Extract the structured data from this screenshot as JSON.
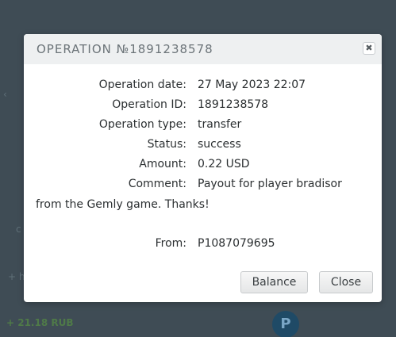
{
  "background": {
    "amount_text": "+ 21.18 RUB",
    "avatar_letter": "P"
  },
  "modal": {
    "title": "OPERATION №1891238578",
    "close_glyph": "✖",
    "fields": {
      "date_label": "Operation date:",
      "date_value": "27 May 2023 22:07",
      "id_label": "Operation ID:",
      "id_value": "1891238578",
      "type_label": "Operation type:",
      "type_value": "transfer",
      "status_label": "Status:",
      "status_value": "success",
      "amount_label": "Amount:",
      "amount_value": "0.22 USD",
      "comment_label": "Comment:",
      "comment_value": "Payout for player bradisor",
      "comment_cont": "from the Gemly game. Thanks!",
      "from_label": "From:",
      "from_value": "P1087079695"
    },
    "buttons": {
      "balance": "Balance",
      "close": "Close"
    }
  },
  "colors": {
    "overlay": "#3f4c55",
    "header_bg": "#eef0f1",
    "title_text": "#6b7378"
  }
}
